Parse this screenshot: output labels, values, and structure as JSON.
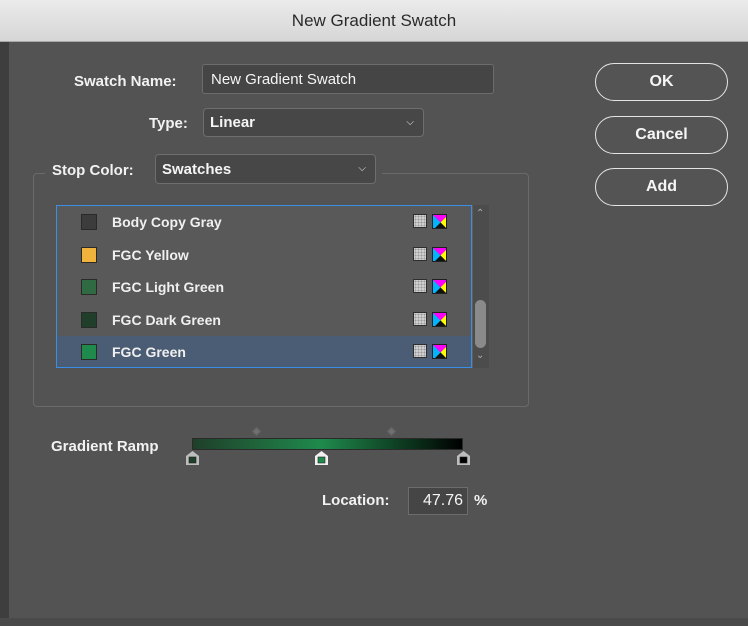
{
  "window": {
    "title": "New Gradient Swatch"
  },
  "form": {
    "swatch_name_label": "Swatch Name:",
    "swatch_name_value": "New Gradient Swatch",
    "type_label": "Type:",
    "type_value": "Linear",
    "stop_color_label": "Stop Color:",
    "stop_color_value": "Swatches"
  },
  "buttons": {
    "ok": "OK",
    "cancel": "Cancel",
    "add": "Add"
  },
  "swatches": [
    {
      "name": "Body Copy Gray",
      "color": "#3c3c3c",
      "selected": false
    },
    {
      "name": "FGC Yellow",
      "color": "#f2b33d",
      "selected": false
    },
    {
      "name": "FGC Light Green",
      "color": "#2f6a43",
      "selected": false
    },
    {
      "name": "FGC Dark Green",
      "color": "#1f3f2a",
      "selected": false
    },
    {
      "name": "FGC Green",
      "color": "#1f8a4c",
      "selected": true
    }
  ],
  "icons": {
    "process_type": "process-color-icon",
    "color_mode": "cmyk-icon",
    "scroll_up": "chevron-up-icon",
    "scroll_down": "chevron-down-icon"
  },
  "scroll": {
    "position": 0.82
  },
  "gradient": {
    "label": "Gradient Ramp",
    "location_label": "Location:",
    "location_value": "47.76",
    "location_unit": "%",
    "stops": [
      {
        "position": 0,
        "color": "#1f3f2a",
        "selected": false
      },
      {
        "position": 47.76,
        "color": "#1f8a4c",
        "selected": true
      },
      {
        "position": 100,
        "color": "#000000",
        "selected": false
      }
    ],
    "midpoints": [
      23.88,
      73.88
    ]
  },
  "colors": {
    "accent": "#3a8ee6",
    "selected_row": "#4a5d74",
    "dialog_bg": "#535353"
  }
}
